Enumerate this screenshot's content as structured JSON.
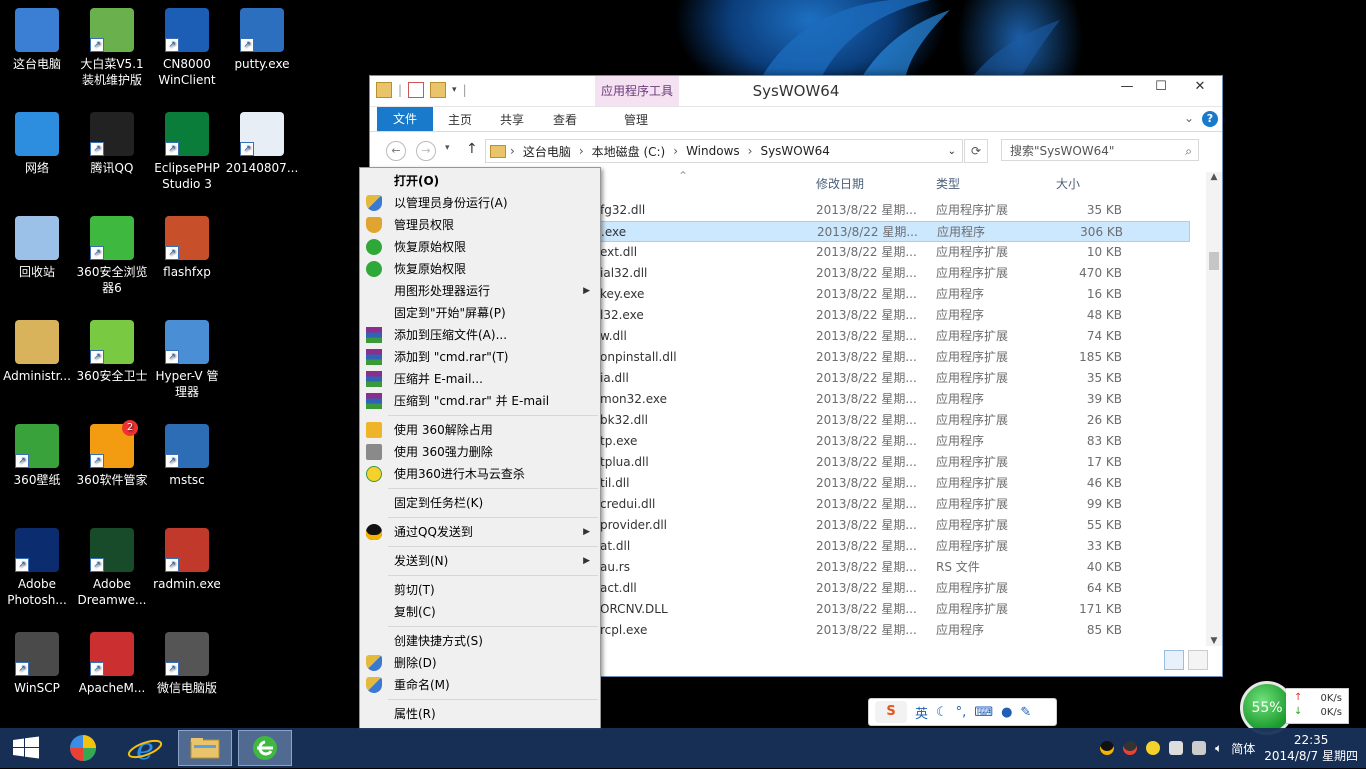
{
  "desktop": {
    "icons": [
      {
        "label": "这台电脑",
        "icon": "computer-icon"
      },
      {
        "label": "大白菜V5.1\n装机维护版",
        "icon": "cabbage-icon"
      },
      {
        "label": "CN8000\nWinClient",
        "icon": "cn8000-icon"
      },
      {
        "label": "putty.exe",
        "icon": "putty-icon"
      },
      {
        "label": "网络",
        "icon": "network-icon"
      },
      {
        "label": "腾讯QQ",
        "icon": "qq-icon"
      },
      {
        "label": "EclipsePHP\nStudio 3",
        "icon": "epp-icon"
      },
      {
        "label": "20140807...",
        "icon": "document-icon"
      },
      {
        "label": "回收站",
        "icon": "recycle-bin-icon"
      },
      {
        "label": "360安全浏览\n器6",
        "icon": "360-browser-icon"
      },
      {
        "label": "flashfxp",
        "icon": "flashfxp-icon"
      },
      {
        "label": "Administr...",
        "icon": "user-folder-icon"
      },
      {
        "label": "360安全卫士",
        "icon": "360-safe-icon"
      },
      {
        "label": "Hyper-V 管\n理器",
        "icon": "hyperv-icon"
      },
      {
        "label": "360壁纸",
        "icon": "360-wallpaper-icon"
      },
      {
        "label": "360软件管家",
        "icon": "360-software-icon"
      },
      {
        "label": "mstsc",
        "icon": "remote-desktop-icon"
      },
      {
        "label": "Adobe\nPhotosh...",
        "icon": "photoshop-icon"
      },
      {
        "label": "Adobe\nDreamwe...",
        "icon": "dreamweaver-icon"
      },
      {
        "label": "radmin.exe",
        "icon": "radmin-icon"
      },
      {
        "label": "WinSCP",
        "icon": "winscp-icon"
      },
      {
        "label": "ApacheM...",
        "icon": "apache-monitor-icon"
      },
      {
        "label": "微信电脑版",
        "icon": "wechat-icon"
      }
    ],
    "badge_360_software": "2"
  },
  "window": {
    "title": "SysWOW64",
    "app_tools": "应用程序工具",
    "tabs": [
      "文件",
      "主页",
      "共享",
      "查看",
      "管理"
    ],
    "breadcrumb": [
      "这台电脑",
      "本地磁盘 (C:)",
      "Windows",
      "SysWOW64"
    ],
    "search_placeholder": "搜索\"SysWOW64\"",
    "columns": [
      "修改日期",
      "类型",
      "大小"
    ],
    "rows": [
      {
        "name": "fg32.dll",
        "date": "2013/8/22 星期...",
        "type": "应用程序扩展",
        "size": "35 KB"
      },
      {
        "name": ".exe",
        "date": "2013/8/22 星期...",
        "type": "应用程序",
        "size": "306 KB",
        "selected": true
      },
      {
        "name": "ext.dll",
        "date": "2013/8/22 星期...",
        "type": "应用程序扩展",
        "size": "10 KB"
      },
      {
        "name": "ial32.dll",
        "date": "2013/8/22 星期...",
        "type": "应用程序扩展",
        "size": "470 KB"
      },
      {
        "name": "key.exe",
        "date": "2013/8/22 星期...",
        "type": "应用程序",
        "size": "16 KB"
      },
      {
        "name": "l32.exe",
        "date": "2013/8/22 星期...",
        "type": "应用程序",
        "size": "48 KB"
      },
      {
        "name": "w.dll",
        "date": "2013/8/22 星期...",
        "type": "应用程序扩展",
        "size": "74 KB"
      },
      {
        "name": "onpinstall.dll",
        "date": "2013/8/22 星期...",
        "type": "应用程序扩展",
        "size": "185 KB"
      },
      {
        "name": "ia.dll",
        "date": "2013/8/22 星期...",
        "type": "应用程序扩展",
        "size": "35 KB"
      },
      {
        "name": "mon32.exe",
        "date": "2013/8/22 星期...",
        "type": "应用程序",
        "size": "39 KB"
      },
      {
        "name": "bk32.dll",
        "date": "2013/8/22 星期...",
        "type": "应用程序扩展",
        "size": "26 KB"
      },
      {
        "name": "tp.exe",
        "date": "2013/8/22 星期...",
        "type": "应用程序",
        "size": "83 KB"
      },
      {
        "name": "tplua.dll",
        "date": "2013/8/22 星期...",
        "type": "应用程序扩展",
        "size": "17 KB"
      },
      {
        "name": "til.dll",
        "date": "2013/8/22 星期...",
        "type": "应用程序扩展",
        "size": "46 KB"
      },
      {
        "name": "credui.dll",
        "date": "2013/8/22 星期...",
        "type": "应用程序扩展",
        "size": "99 KB"
      },
      {
        "name": "provider.dll",
        "date": "2013/8/22 星期...",
        "type": "应用程序扩展",
        "size": "55 KB"
      },
      {
        "name": "at.dll",
        "date": "2013/8/22 星期...",
        "type": "应用程序扩展",
        "size": "33 KB"
      },
      {
        "name": "au.rs",
        "date": "2013/8/22 星期...",
        "type": "RS 文件",
        "size": "40 KB"
      },
      {
        "name": "act.dll",
        "date": "2013/8/22 星期...",
        "type": "应用程序扩展",
        "size": "64 KB"
      },
      {
        "name": "ORCNV.DLL",
        "date": "2013/8/22 星期...",
        "type": "应用程序扩展",
        "size": "171 KB"
      },
      {
        "name": "rcpl.exe",
        "date": "2013/8/22 星期...",
        "type": "应用程序",
        "size": "85 KB"
      }
    ]
  },
  "context_menu": {
    "items": [
      {
        "label": "打开(O)",
        "icon": "",
        "bold": true
      },
      {
        "label": "以管理员身份运行(A)",
        "icon": "uac-shield-icon"
      },
      {
        "label": "管理员权限",
        "icon": "shield-orange-icon"
      },
      {
        "label": "恢复原始权限",
        "icon": "green-shield-icon"
      },
      {
        "label": "恢复原始权限",
        "icon": "green-shield-icon"
      },
      {
        "label": "用图形处理器运行",
        "icon": "",
        "submenu": true
      },
      {
        "label": "固定到\"开始\"屏幕(P)",
        "icon": ""
      },
      {
        "label": "添加到压缩文件(A)...",
        "icon": "winrar-icon"
      },
      {
        "label": "添加到 \"cmd.rar\"(T)",
        "icon": "winrar-icon"
      },
      {
        "label": "压缩并 E-mail...",
        "icon": "winrar-icon"
      },
      {
        "label": "压缩到 \"cmd.rar\" 并 E-mail",
        "icon": "winrar-icon"
      },
      {
        "label": "使用 360解除占用",
        "icon": "360-unlock-icon"
      },
      {
        "label": "使用 360强力删除",
        "icon": "360-shred-icon"
      },
      {
        "label": "使用360进行木马云查杀",
        "icon": "360-scan-icon"
      },
      {
        "label": "固定到任务栏(K)",
        "icon": ""
      },
      {
        "label": "通过QQ发送到",
        "icon": "qq-penguin-icon",
        "submenu": true
      },
      {
        "label": "发送到(N)",
        "icon": "",
        "submenu": true
      },
      {
        "label": "剪切(T)",
        "icon": ""
      },
      {
        "label": "复制(C)",
        "icon": ""
      },
      {
        "label": "创建快捷方式(S)",
        "icon": ""
      },
      {
        "label": "删除(D)",
        "icon": "uac-shield-icon"
      },
      {
        "label": "重命名(M)",
        "icon": "uac-shield-icon"
      },
      {
        "label": "属性(R)",
        "icon": ""
      }
    ]
  },
  "ime": {
    "mode": "英"
  },
  "float_ball": {
    "percent": "55%",
    "up": "0K/s",
    "down": "0K/s"
  },
  "taskbar": {
    "lang": "简体",
    "time": "22:35",
    "date": "2014/8/7 星期四"
  },
  "colors": {
    "accent": "#1979ca",
    "selection": "#cce8ff",
    "taskbar": "#19325a"
  }
}
